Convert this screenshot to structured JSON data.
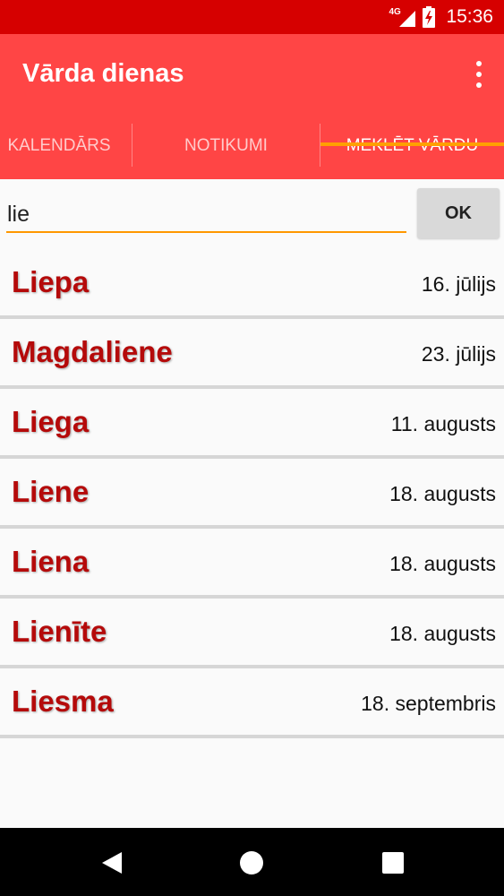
{
  "status_bar": {
    "network": "4G",
    "time": "15:36",
    "icons": [
      "signal-icon",
      "battery-charging-icon"
    ]
  },
  "app": {
    "title": "Vārda dienas"
  },
  "tabs": [
    {
      "label": "KALENDĀRS",
      "active": false
    },
    {
      "label": "NOTIKUMI",
      "active": false
    },
    {
      "label": "MEKLĒT VĀRDU",
      "active": true
    }
  ],
  "search": {
    "value": "lie",
    "ok_label": "OK"
  },
  "results": [
    {
      "name": "Liepa",
      "date": "16. jūlijs"
    },
    {
      "name": "Magdaliene",
      "date": "23. jūlijs"
    },
    {
      "name": "Liega",
      "date": "11. augusts"
    },
    {
      "name": "Liene",
      "date": "18. augusts"
    },
    {
      "name": "Liena",
      "date": "18. augusts"
    },
    {
      "name": "Lienīte",
      "date": "18. augusts"
    },
    {
      "name": "Liesma",
      "date": "18. septembris"
    }
  ],
  "colors": {
    "status_bar": "#d60000",
    "app_bar": "#ff4545",
    "tab_indicator": "#ffa000",
    "name_text": "#b50a0a"
  },
  "nav": [
    "back-icon",
    "home-icon",
    "recents-icon"
  ]
}
